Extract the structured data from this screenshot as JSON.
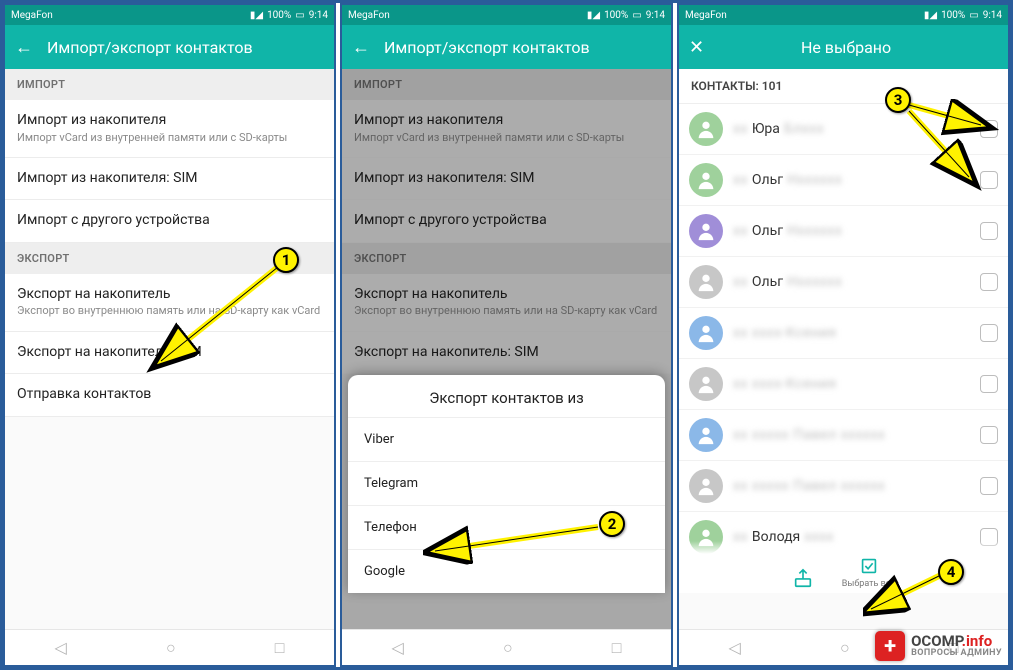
{
  "status": {
    "carrier": "MegaFon",
    "battery": "100%",
    "time": "9:14"
  },
  "screen1": {
    "title": "Импорт/экспорт контактов",
    "sections": {
      "import": "ИМПОРТ",
      "export": "ЭКСПОРТ"
    },
    "items": {
      "imp_storage": {
        "label": "Импорт из накопителя",
        "sub": "Импорт vCard из внутренней памяти или с SD-карты"
      },
      "imp_sim": {
        "label": "Импорт из накопителя: SIM"
      },
      "imp_device": {
        "label": "Импорт с другого устройства"
      },
      "exp_storage": {
        "label": "Экспорт на накопитель",
        "sub": "Экспорт во внутреннюю память или на SD-карту как vCard"
      },
      "exp_sim": {
        "label": "Экспорт на накопитель: SIM"
      },
      "send": {
        "label": "Отправка контактов"
      }
    }
  },
  "screen2": {
    "title": "Импорт/экспорт контактов",
    "sheet": {
      "title": "Экспорт контактов из",
      "options": [
        "Viber",
        "Telegram",
        "Телефон",
        "Google"
      ]
    }
  },
  "screen3": {
    "title": "Не выбрано",
    "count_label": "КОНТАКТЫ: 101",
    "contacts": [
      {
        "name": "Юра",
        "surname_blur": "Блххх",
        "avatar": "green"
      },
      {
        "name": "Ольг",
        "surname_blur": "Нхххххх",
        "avatar": "green"
      },
      {
        "name": "Ольг",
        "surname_blur": "Нхххххх",
        "avatar": "purple"
      },
      {
        "name": "Ольг",
        "surname_blur": "Нхххххх",
        "avatar": "grey"
      },
      {
        "name": "",
        "surname_blur": "хххх-Ксения",
        "avatar": "blue"
      },
      {
        "name": "",
        "surname_blur": "хххх-Ксения",
        "avatar": "grey"
      },
      {
        "name": "",
        "surname_blur": "ххххх Павел хххххх",
        "avatar": "blue"
      },
      {
        "name": "",
        "surname_blur": "ххххх Павел хххххх",
        "avatar": "grey"
      },
      {
        "name": "Володя",
        "surname_blur": "хххх",
        "avatar": "green"
      }
    ],
    "bottom": {
      "share": "",
      "select_all": "Выбрать все"
    }
  },
  "markers": {
    "1": "1",
    "2": "2",
    "3": "3",
    "4": "4"
  },
  "watermark": {
    "domain": "OCOMP",
    "tld": ".info",
    "sub": "ВОПРОСЫ АДМИНУ",
    "plus": "+"
  }
}
